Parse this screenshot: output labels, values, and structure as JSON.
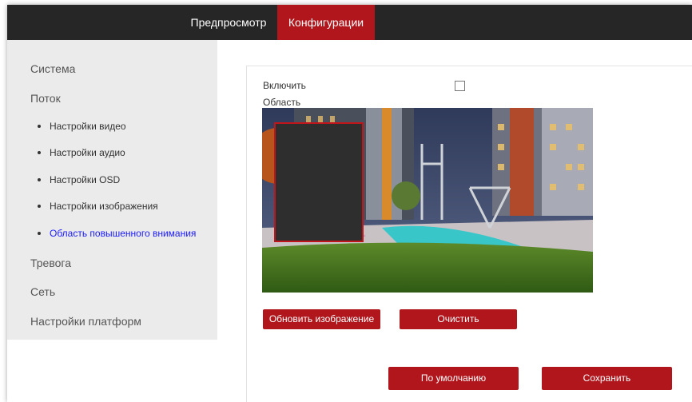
{
  "header": {
    "tabs": [
      {
        "label": "Предпросмотр",
        "active": false
      },
      {
        "label": "Конфигурации",
        "active": true
      }
    ]
  },
  "sidebar": {
    "items": [
      {
        "label": "Система"
      },
      {
        "label": "Поток"
      },
      {
        "label": "Тревога"
      },
      {
        "label": "Сеть"
      },
      {
        "label": "Настройки платформ"
      }
    ],
    "sub_items": [
      {
        "label": "Настройки видео"
      },
      {
        "label": "Настройки аудио"
      },
      {
        "label": "Настройки OSD"
      },
      {
        "label": "Настройки изображения"
      },
      {
        "label": "Область повышенного внимания",
        "active": true
      }
    ]
  },
  "main": {
    "enable_label": "Включить",
    "enable_checked": false,
    "area_label": "Область",
    "buttons": {
      "refresh": "Обновить изображение",
      "clear": "Очистить",
      "default": "По умолчанию",
      "save": "Сохранить"
    }
  },
  "colors": {
    "accent": "#b0161c",
    "topbar": "#262626",
    "sidebar_bg": "#ebebeb",
    "active_link": "#1a1aff",
    "mask_fill": "#2e2e2e"
  },
  "icons": [
    "checkbox-icon"
  ]
}
